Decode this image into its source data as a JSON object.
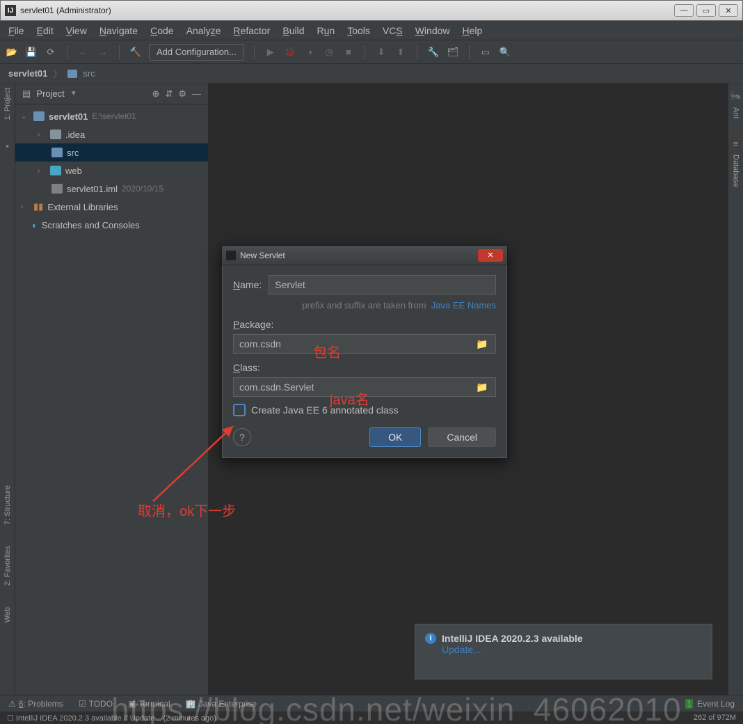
{
  "window": {
    "title": "servlet01 (Administrator)"
  },
  "menu": [
    "File",
    "Edit",
    "View",
    "Navigate",
    "Code",
    "Analyze",
    "Refactor",
    "Build",
    "Run",
    "Tools",
    "VCS",
    "Window",
    "Help"
  ],
  "toolbar": {
    "addConfig": "Add Configuration..."
  },
  "crumbs": {
    "root": "servlet01",
    "child": "src"
  },
  "sidebar": {
    "title": "Project",
    "root": {
      "name": "servlet01",
      "path": "E:\\servlet01"
    },
    "items": [
      {
        "name": ".idea"
      },
      {
        "name": "src"
      },
      {
        "name": "web"
      },
      {
        "name": "servlet01.iml",
        "meta": "2020/10/15"
      }
    ],
    "ext": "External Libraries",
    "scratches": "Scratches and Consoles"
  },
  "leftTabs": [
    "1: Project",
    "7: Structure",
    "2: Favorites",
    "Web"
  ],
  "rightTabs": [
    "Ant",
    "Database"
  ],
  "dialog": {
    "title": "New Servlet",
    "nameLabel": "Name:",
    "nameValue": "Servlet",
    "hintPrefix": "prefix and suffix are taken from",
    "hintLink": "Java EE Names",
    "packageLabel": "Package:",
    "packageValue": "com.csdn",
    "classLabel": "Class:",
    "classValue": "com.csdn.Servlet",
    "checkboxLabel": "Create Java EE 6 annotated class",
    "ok": "OK",
    "cancel": "Cancel"
  },
  "annotations": {
    "pkg": "包名",
    "java": "java名",
    "bottom": "取消，ok下一步"
  },
  "notification": {
    "title": "IntelliJ IDEA 2020.2.3 available",
    "link": "Update..."
  },
  "bottom": {
    "problems": "6: Problems",
    "todo": "TODO",
    "terminal": "Terminal",
    "javaee": "Java Enterprise",
    "event": "Event Log"
  },
  "status": {
    "left": "IntelliJ IDEA 2020.2.3 available // Update... (2 minutes ago)",
    "right": "262 of 972M"
  },
  "watermark": "https://blog.csdn.net/weixin_46062010"
}
